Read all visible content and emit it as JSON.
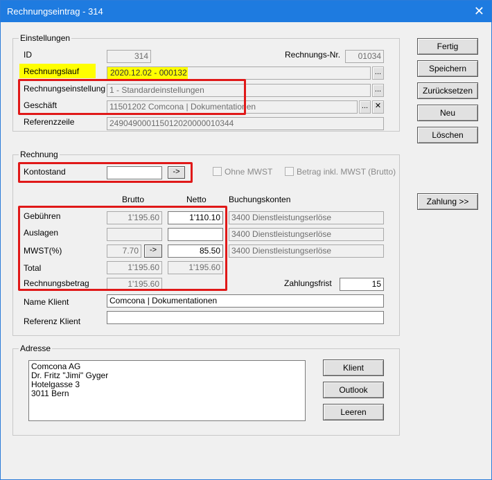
{
  "window": {
    "title": "Rechnungseintrag - 314",
    "close_icon": "✕"
  },
  "einstellungen": {
    "legend": "Einstellungen",
    "id_label": "ID",
    "id_value": "314",
    "rechnungsnr_label": "Rechnungs-Nr.",
    "rechnungsnr_value": "01034",
    "rechnungslauf_label": "Rechnungslauf",
    "rechnungslauf_value": "2020.12.02 - 000132",
    "rechnungseinstellung_label": "Rechnungseinstellung",
    "rechnungseinstellung_value": "1 -  Standardeinstellungen",
    "geschaeft_label": "Geschäft",
    "geschaeft_value": "11501202  Comcona | Dokumentationen",
    "referenzzeile_label": "Referenzzeile",
    "referenzzeile_value": "249049000115012020000010344",
    "browse_label": "...",
    "clear_label": "✕"
  },
  "rechnung": {
    "legend": "Rechnung",
    "kontostand_label": "Kontostand",
    "kontostand_value": "",
    "arrow_label": "->",
    "ohne_mwst_label": "Ohne MWST",
    "betrag_inkl_label": "Betrag inkl. MWST (Brutto)",
    "col_brutto": "Brutto",
    "col_netto": "Netto",
    "col_buchungskonten": "Buchungskonten",
    "rows": [
      {
        "label": "Gebühren",
        "brutto": "1'195.60",
        "netto": "1'110.10",
        "konto": "3400  Dienstleistungserlöse"
      },
      {
        "label": "Auslagen",
        "brutto": "",
        "netto": "",
        "konto": "3400  Dienstleistungserlöse"
      },
      {
        "label": "MWST(%)",
        "brutto": "7.70",
        "netto": "85.50",
        "konto": "3400  Dienstleistungserlöse"
      },
      {
        "label": "Total",
        "brutto": "1'195.60",
        "netto": "1'195.60"
      },
      {
        "label": "Rechnungsbetrag",
        "brutto": "1'195.60"
      }
    ],
    "zahlungsfrist_label": "Zahlungsfrist",
    "zahlungsfrist_value": "15",
    "name_klient_label": "Name Klient",
    "name_klient_value": "Comcona | Dokumentationen",
    "referenz_klient_label": "Referenz Klient",
    "referenz_klient_value": ""
  },
  "adresse": {
    "legend": "Adresse",
    "lines": [
      "Comcona AG",
      "Dr. Fritz \"Jimi\" Gyger",
      "Hotelgasse 3",
      "3011 Bern"
    ],
    "klient_label": "Klient",
    "outlook_label": "Outlook",
    "leeren_label": "Leeren"
  },
  "buttons": {
    "fertig": "Fertig",
    "speichern": "Speichern",
    "zuruecksetzen": "Zurücksetzen",
    "neu": "Neu",
    "loeschen": "Löschen",
    "zahlung": "Zahlung >>"
  },
  "colors": {
    "titlebar": "#1e7be0",
    "highlight_yellow": "#ffff00",
    "annotation_red": "#e01818"
  }
}
